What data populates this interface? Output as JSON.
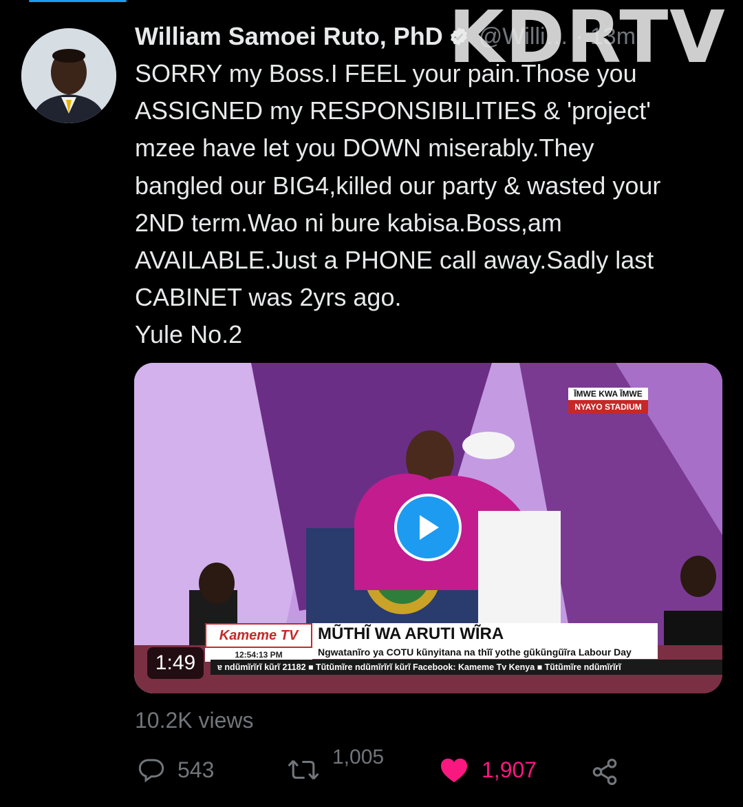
{
  "author": {
    "name": "William Samoei Ruto, PhD",
    "handle": "@Willi…",
    "separator": "·",
    "time": "13m",
    "verified": true
  },
  "watermark": "KDRTV",
  "tweet": {
    "text": "SORRY my Boss.I FEEL your pain.Those you\nASSIGNED my RESPONSIBILITIES & 'project'\nmzee have let you DOWN miserably.They\nbangled our BIG4,killed our party & wasted your\n2ND term.Wao ni bure kabisa.Boss,am\nAVAILABLE.Just a PHONE call away.Sadly last\nCABINET was 2yrs ago.\nYule No.2"
  },
  "video": {
    "duration": "1:49",
    "location_top": "ĨMWE KWA ĨMWE",
    "location_bottom": "NYAYO STADIUM",
    "channel": "Kameme TV",
    "channel_time": "12:54:13 PM",
    "headline": "MŨTHĨ WA ARUTI WĨRA",
    "subheadline": "Ngwatanĩro ya COTU kũnyitana na thĩĩ yothe gũkũngũĩra Labour Day",
    "ticker": "ɐ ndũmĩrĩrĩ kũrĩ 21182  ■ Tũtũmĩre ndũmĩrĩrĩ kũrĩ Facebook: Kameme Tv Kenya  ■ Tũtũmĩre ndũmĩrĩrĩ"
  },
  "stats": {
    "views": "10.2K views",
    "replies": "543",
    "retweets": "1,005",
    "likes": "1,907"
  },
  "colors": {
    "background": "#000000",
    "text": "#e7e9ea",
    "muted": "#71767b",
    "accent": "#1d9bf0",
    "like": "#f91880"
  },
  "icons": [
    "reply-icon",
    "retweet-icon",
    "like-icon",
    "share-icon",
    "verified-icon",
    "play-icon"
  ]
}
